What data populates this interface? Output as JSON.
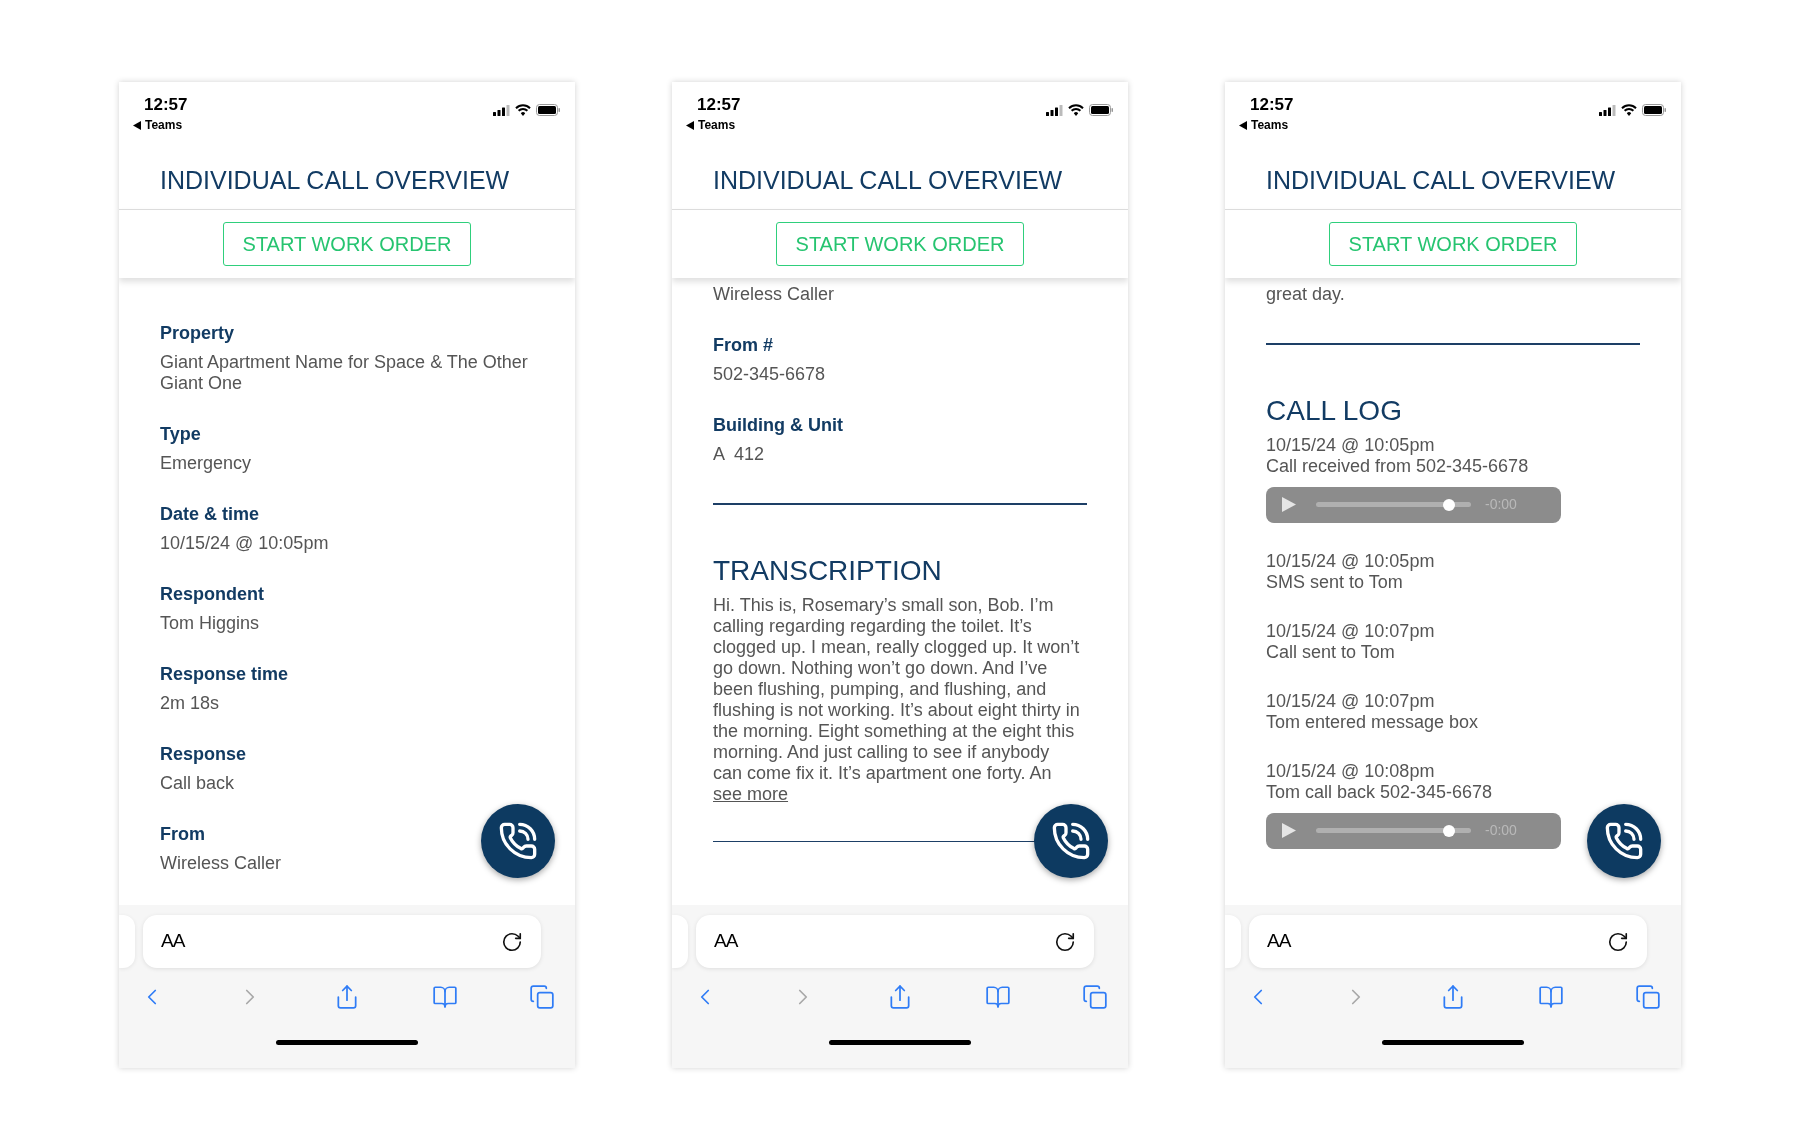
{
  "screens": [
    {
      "status_bar": {
        "time": "12:57",
        "back_app": "Teams"
      },
      "title": "INDIVIDUAL CALL OVERVIEW",
      "action_button": "START WORK ORDER",
      "content": [
        {
          "kind": "field",
          "label": "Property",
          "value": "Giant Apartment Name for Space & The Other Giant One"
        },
        {
          "kind": "field",
          "label": "Type",
          "value": "Emergency"
        },
        {
          "kind": "field",
          "label": "Date & time",
          "value": "10/15/24 @ 10:05pm"
        },
        {
          "kind": "field",
          "label": "Respondent",
          "value": "Tom Higgins"
        },
        {
          "kind": "field",
          "label": "Response time",
          "value": "2m 18s"
        },
        {
          "kind": "field",
          "label": "Response",
          "value": "Call back"
        },
        {
          "kind": "field",
          "label": "From",
          "value": "Wireless Caller"
        }
      ],
      "browser": {
        "text_size": "AA",
        "nav": [
          {
            "kind": "back",
            "disabled": false
          },
          {
            "kind": "forward",
            "disabled": true
          },
          {
            "kind": "share",
            "disabled": false
          },
          {
            "kind": "bookmarks",
            "disabled": false
          },
          {
            "kind": "tabs",
            "disabled": false
          }
        ]
      }
    },
    {
      "status_bar": {
        "time": "12:57",
        "back_app": "Teams"
      },
      "title": "INDIVIDUAL CALL OVERVIEW",
      "action_button": "START WORK ORDER",
      "content": [
        {
          "kind": "text",
          "text": "Wireless Caller"
        },
        {
          "kind": "field",
          "label": "From #",
          "value": "502-345-6678"
        },
        {
          "kind": "field",
          "label": "Building & Unit",
          "value": "A  412"
        },
        {
          "kind": "divider"
        },
        {
          "kind": "heading",
          "text": "TRANSCRIPTION"
        },
        {
          "kind": "paragraph",
          "text": "Hi. This is, Rosemary’s small son, Bob. I’m calling regarding regarding the toilet. It’s clogged up. I mean, really clogged up. It won’t go down. Nothing won’t go down. And I’ve been flushing, pumping, and flushing, and flushing is not working. It’s about eight thirty in the morning. Eight something at the eight this morning. And just calling to see if anybody can come fix it. It’s apartment one forty. An",
          "link": "see more"
        },
        {
          "kind": "divider"
        }
      ],
      "browser": {
        "text_size": "AA",
        "nav": [
          {
            "kind": "back",
            "disabled": false
          },
          {
            "kind": "forward",
            "disabled": true
          },
          {
            "kind": "share",
            "disabled": false
          },
          {
            "kind": "bookmarks",
            "disabled": false
          },
          {
            "kind": "tabs",
            "disabled": false
          }
        ]
      }
    },
    {
      "status_bar": {
        "time": "12:57",
        "back_app": "Teams"
      },
      "title": "INDIVIDUAL CALL OVERVIEW",
      "action_button": "START WORK ORDER",
      "content": [
        {
          "kind": "text",
          "text": "great day."
        },
        {
          "kind": "divider"
        },
        {
          "kind": "heading",
          "text": "CALL LOG"
        },
        {
          "kind": "log",
          "time": "10/15/24 @ 10:05pm",
          "text": "Call received from 502-345-6678",
          "audio": {
            "remaining": "-0:00",
            "level": 0.86
          }
        },
        {
          "kind": "log",
          "time": "10/15/24 @ 10:05pm",
          "text": "SMS sent to Tom"
        },
        {
          "kind": "log",
          "time": "10/15/24 @ 10:07pm",
          "text": "Call sent to Tom"
        },
        {
          "kind": "log",
          "time": "10/15/24 @ 10:07pm",
          "text": "Tom entered message box"
        },
        {
          "kind": "log",
          "time": "10/15/24 @ 10:08pm",
          "text": "Tom call back 502-345-6678",
          "audio": {
            "remaining": "-0:00",
            "level": 0.86
          }
        }
      ],
      "browser": {
        "text_size": "AA",
        "nav": [
          {
            "kind": "back",
            "disabled": false
          },
          {
            "kind": "forward",
            "disabled": true
          },
          {
            "kind": "share",
            "disabled": false
          },
          {
            "kind": "bookmarks",
            "disabled": false
          },
          {
            "kind": "tabs",
            "disabled": false
          }
        ]
      }
    }
  ]
}
